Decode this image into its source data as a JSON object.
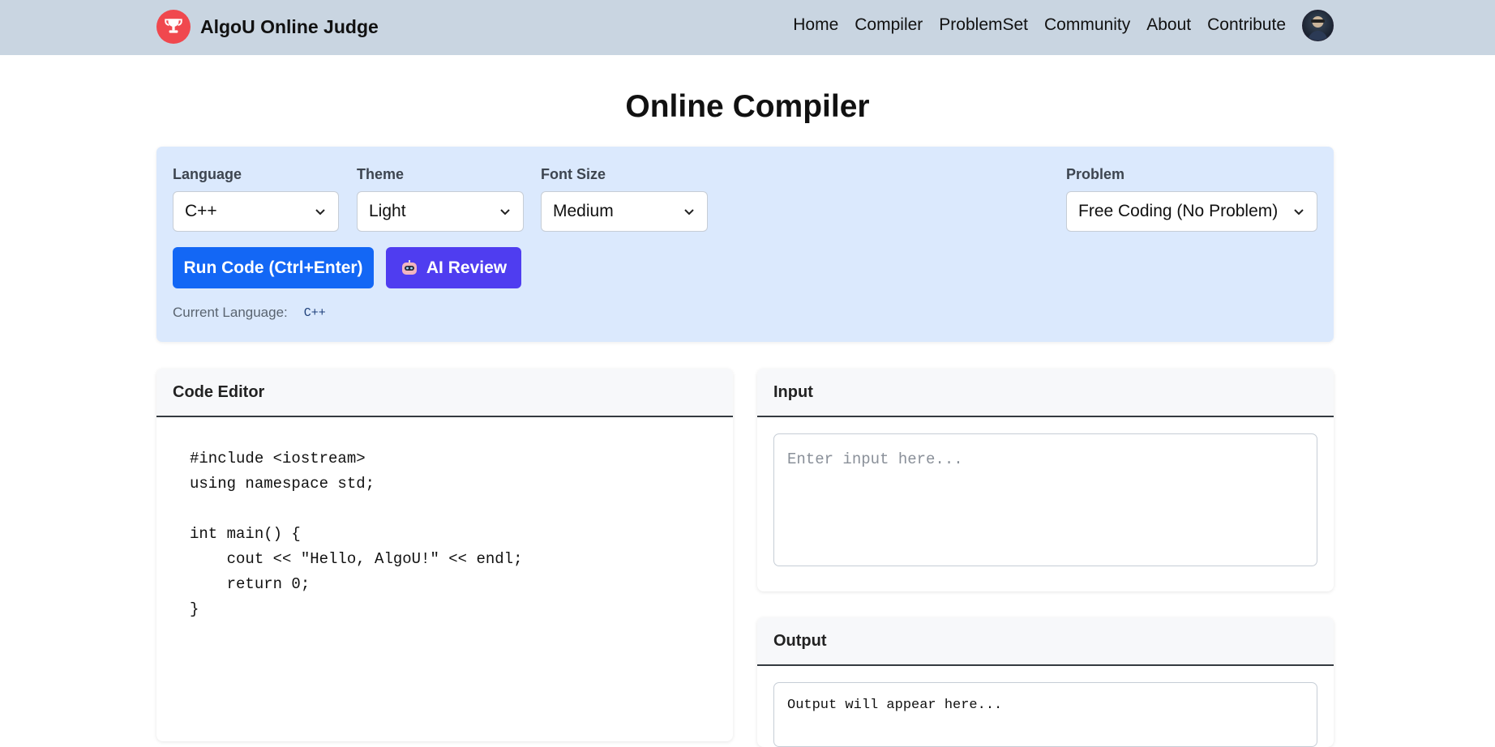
{
  "brand": {
    "name": "AlgoU Online Judge",
    "logo_icon": "trophy-icon",
    "logo_color": "#f0484e"
  },
  "nav": {
    "items": [
      {
        "label": "Home"
      },
      {
        "label": "Compiler"
      },
      {
        "label": "ProblemSet"
      },
      {
        "label": "Community"
      },
      {
        "label": "About"
      },
      {
        "label": "Contribute"
      }
    ]
  },
  "page": {
    "title": "Online Compiler"
  },
  "controls": {
    "language": {
      "label": "Language",
      "value": "C++"
    },
    "theme": {
      "label": "Theme",
      "value": "Light"
    },
    "font_size": {
      "label": "Font Size",
      "value": "Medium"
    },
    "problem": {
      "label": "Problem",
      "value": "Free Coding (No Problem)"
    },
    "run_button": "Run Code (Ctrl+Enter)",
    "ai_button": "AI Review",
    "current_language_label": "Current Language:",
    "current_language_value": "C++",
    "colors": {
      "panel_bg": "#dbe9fd",
      "run_bg": "#1367f5",
      "ai_bg": "#4f3df0"
    }
  },
  "editor": {
    "title": "Code Editor",
    "code": "#include <iostream>\nusing namespace std;\n\nint main() {\n    cout << \"Hello, AlgoU!\" << endl;\n    return 0;\n}"
  },
  "input": {
    "title": "Input",
    "placeholder": "Enter input here..."
  },
  "output": {
    "title": "Output",
    "text": "Output will appear here..."
  }
}
